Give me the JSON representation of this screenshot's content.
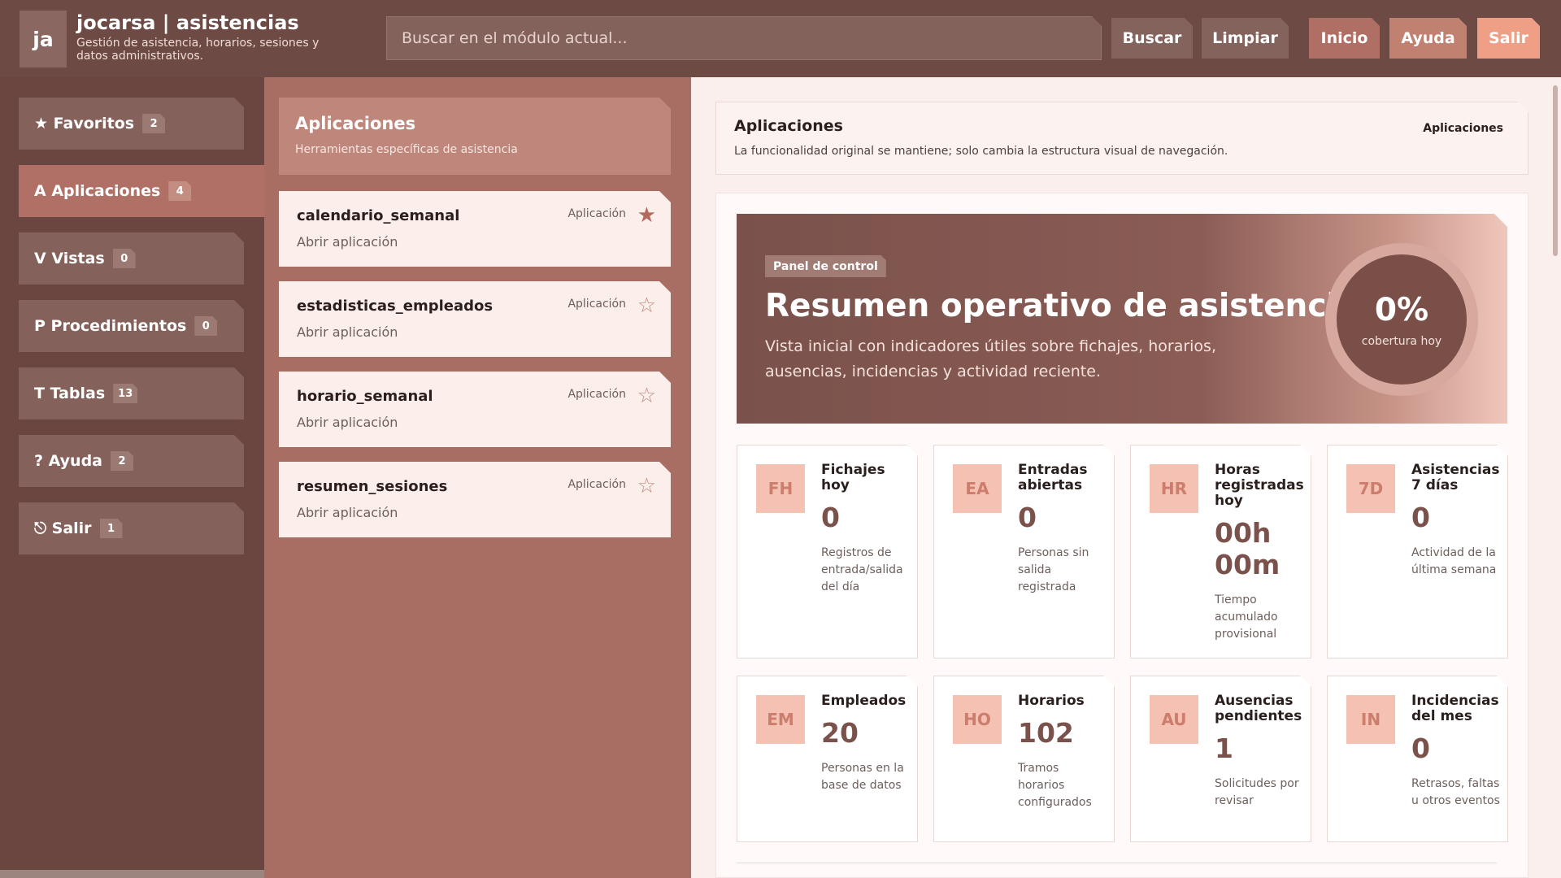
{
  "header": {
    "logo": "ja",
    "title": "jocarsa | asistencias",
    "subtitle": "Gestión de asistencia, horarios, sesiones y datos administrativos.",
    "search_placeholder": "Buscar en el módulo actual...",
    "search_value": "",
    "buttons": {
      "buscar": "Buscar",
      "limpiar": "Limpiar",
      "inicio": "Inicio",
      "ayuda": "Ayuda",
      "salir": "Salir"
    }
  },
  "nav": {
    "items": [
      {
        "label": "★ Favoritos",
        "count": "2"
      },
      {
        "label": "A Aplicaciones",
        "count": "4"
      },
      {
        "label": "V Vistas",
        "count": "0"
      },
      {
        "label": "P Procedimientos",
        "count": "0"
      },
      {
        "label": "T Tablas",
        "count": "13"
      },
      {
        "label": "? Ayuda",
        "count": "2"
      },
      {
        "label": "⎋ Salir",
        "count": "1"
      }
    ],
    "active": "A Aplicaciones"
  },
  "apps_panel": {
    "title": "Aplicaciones",
    "subtitle": "Herramientas específicas de asistencia",
    "cards": [
      {
        "name": "calendario_semanal",
        "type": "Aplicación",
        "action": "Abrir aplicación",
        "star": "★"
      },
      {
        "name": "estadisticas_empleados",
        "type": "Aplicación",
        "action": "Abrir aplicación",
        "star": "☆"
      },
      {
        "name": "horario_semanal",
        "type": "Aplicación",
        "action": "Abrir aplicación",
        "star": "☆"
      },
      {
        "name": "resumen_sesiones",
        "type": "Aplicación",
        "action": "Abrir aplicación",
        "star": "☆"
      }
    ]
  },
  "context": {
    "title": "Aplicaciones",
    "description": "La funcionalidad original se mantiene; solo cambia la estructura visual de navegación.",
    "tag": "Aplicaciones"
  },
  "hero": {
    "badge": "Panel de control",
    "title": "Resumen operativo de asistencias",
    "description": "Vista inicial con indicadores útiles sobre fichajes, horarios, ausencias, incidencias y actividad reciente.",
    "gauge_value": "0%",
    "gauge_label": "cobertura hoy"
  },
  "stats": [
    {
      "abbr": "FH",
      "label": "Fichajes hoy",
      "value": "0",
      "desc": "Registros de entrada/salida del día"
    },
    {
      "abbr": "EA",
      "label": "Entradas abiertas",
      "value": "0",
      "desc": "Personas sin salida registrada"
    },
    {
      "abbr": "HR",
      "label": "Horas registradas hoy",
      "value": "00h 00m",
      "desc": "Tiempo acumulado provisional"
    },
    {
      "abbr": "7D",
      "label": "Asistencias 7 días",
      "value": "0",
      "desc": "Actividad de la última semana"
    },
    {
      "abbr": "EM",
      "label": "Empleados",
      "value": "20",
      "desc": "Personas en la base de datos"
    },
    {
      "abbr": "HO",
      "label": "Horarios",
      "value": "102",
      "desc": "Tramos horarios configurados"
    },
    {
      "abbr": "AU",
      "label": "Ausencias pendientes",
      "value": "1",
      "desc": "Solicitudes por revisar"
    },
    {
      "abbr": "IN",
      "label": "Incidencias del mes",
      "value": "0",
      "desc": "Retrasos, faltas u otros eventos"
    }
  ],
  "colors": {
    "header_bg": "#6d4a44",
    "nav_bg": "#6b4640",
    "panel_bg": "#a96e63",
    "accent": "#ee9f86",
    "icon_bg": "#f4c1b3"
  }
}
